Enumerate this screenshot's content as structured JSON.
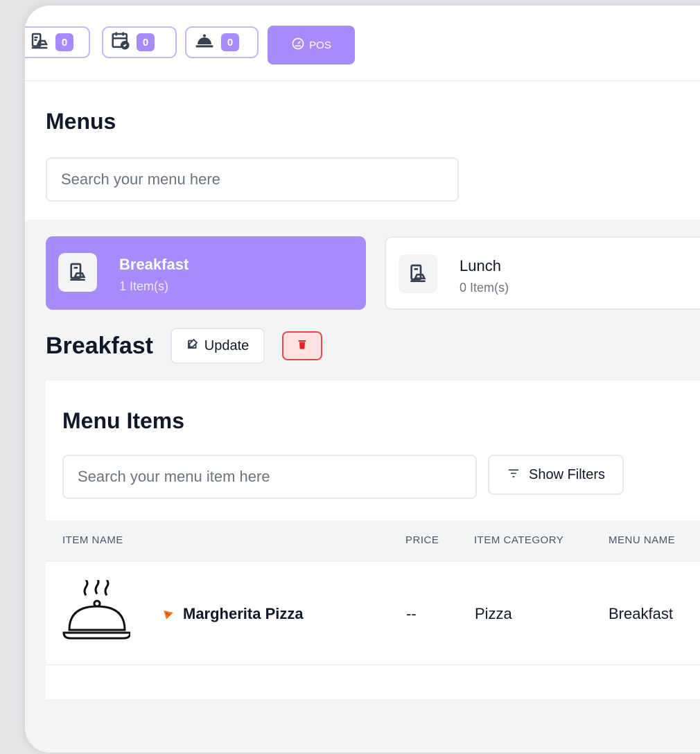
{
  "topbar": {
    "chips": [
      {
        "icon": "menu-book-icon",
        "count": "0"
      },
      {
        "icon": "calendar-check-icon",
        "count": "0"
      },
      {
        "icon": "cloche-icon",
        "count": "0"
      }
    ],
    "pos_label": "POS"
  },
  "menus": {
    "title": "Menus",
    "search_placeholder": "Search your menu here",
    "cards": [
      {
        "name": "Breakfast",
        "count": "1 Item(s)"
      },
      {
        "name": "Lunch",
        "count": "0 Item(s)"
      }
    ]
  },
  "selected_menu": {
    "title": "Breakfast",
    "update_label": "Update"
  },
  "menu_items": {
    "title": "Menu Items",
    "search_placeholder": "Search your menu item here",
    "filters_label": "Show Filters",
    "columns": [
      "ITEM NAME",
      "PRICE",
      "ITEM CATEGORY",
      "MENU NAME"
    ],
    "rows": [
      {
        "name": "Margherita Pizza",
        "price": "--",
        "category": "Pizza",
        "menu": "Breakfast"
      }
    ]
  },
  "colors": {
    "accent": "#a78bfa",
    "danger": "#ef4444"
  }
}
